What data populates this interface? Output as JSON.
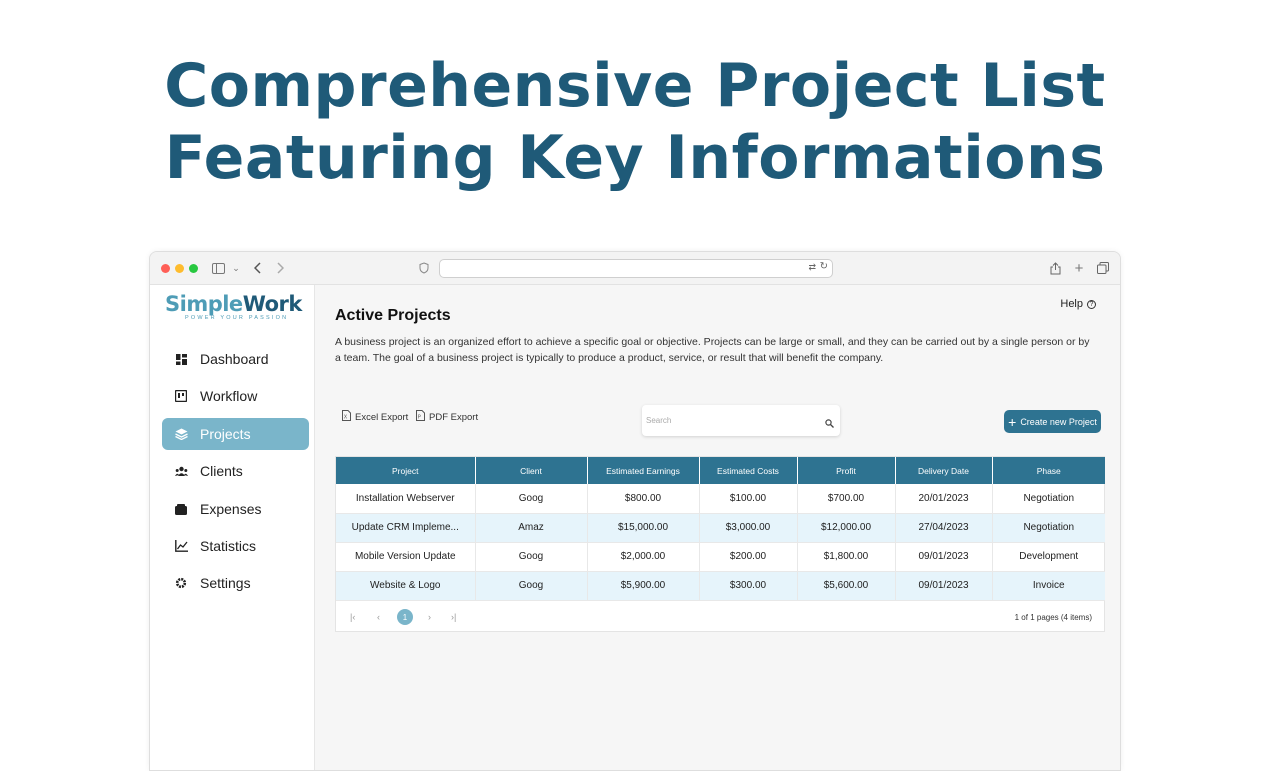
{
  "hero": {
    "line1": "Comprehensive Project List",
    "line2": "Featuring Key Informations"
  },
  "browser": {
    "traffic_lights": [
      "#ff5f57",
      "#febc2e",
      "#28c840"
    ],
    "icons": [
      "sidebar-toggle-icon",
      "chevron-down-icon",
      "back-icon",
      "forward-icon",
      "shield-icon",
      "translate-icon",
      "reload-icon",
      "share-icon",
      "new-tab-icon",
      "tabs-overview-icon"
    ]
  },
  "logo": {
    "part1": "Simple",
    "part2": "Work",
    "tagline": "POWER YOUR PASSION"
  },
  "sidebar": {
    "items": [
      {
        "label": "Dashboard",
        "icon": "dashboard-icon"
      },
      {
        "label": "Workflow",
        "icon": "workflow-icon"
      },
      {
        "label": "Projects",
        "icon": "layers-icon",
        "active": true
      },
      {
        "label": "Clients",
        "icon": "users-icon"
      },
      {
        "label": "Expenses",
        "icon": "wallet-icon"
      },
      {
        "label": "Statistics",
        "icon": "chart-line-icon"
      },
      {
        "label": "Settings",
        "icon": "gear-icon"
      }
    ]
  },
  "header": {
    "help": "Help",
    "help_icon": "?",
    "title": "Active Projects",
    "description": "A business project is an organized effort to achieve a specific goal or objective. Projects can be large or small, and they can be carried out by a single person or by a team. The goal of a business project is typically to produce a product, service, or result that will benefit the company."
  },
  "toolbar": {
    "excel_export": "Excel Export",
    "pdf_export": "PDF Export",
    "search_placeholder": "Search",
    "search_value": "",
    "create_plus": "+",
    "create_label": "Create new Project"
  },
  "table": {
    "columns": [
      "Project",
      "Client",
      "Estimated Earnings",
      "Estimated Costs",
      "Profit",
      "Delivery Date",
      "Phase"
    ],
    "rows": [
      [
        "Installation Webserver",
        "Goog",
        "$800.00",
        "$100.00",
        "$700.00",
        "20/01/2023",
        "Negotiation"
      ],
      [
        "Update CRM Impleme...",
        "Amaz",
        "$15,000.00",
        "$3,000.00",
        "$12,000.00",
        "27/04/2023",
        "Negotiation"
      ],
      [
        "Mobile Version Update",
        "Goog",
        "$2,000.00",
        "$200.00",
        "$1,800.00",
        "09/01/2023",
        "Development"
      ],
      [
        "Website & Logo",
        "Goog",
        "$5,900.00",
        "$300.00",
        "$5,600.00",
        "09/01/2023",
        "Invoice"
      ]
    ]
  },
  "pagination": {
    "first": "|‹",
    "prev": "‹",
    "current": "1",
    "next": "›",
    "last": "›|",
    "info": "1 of 1 pages (4 items)"
  },
  "colors": {
    "accent": "#2e7391",
    "sidebar_active": "#7ab5ca",
    "row_alt": "#e6f4fb",
    "hero_text": "#1f5a78"
  }
}
